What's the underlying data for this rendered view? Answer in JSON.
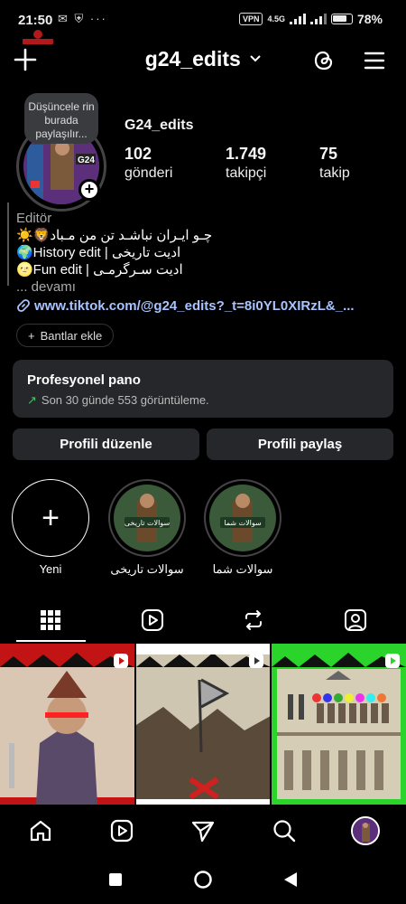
{
  "status": {
    "time": "21:50",
    "left_icons": "✉ ⛨ ···",
    "vpn": "VPN",
    "network": "4.5G",
    "battery_pct": "78%"
  },
  "header": {
    "username": "g24_edits"
  },
  "profile": {
    "note": "Düşüncele rin burada paylaşılır...",
    "display_name": "G24_edits",
    "stats": [
      {
        "value": "102",
        "label": "gönderi"
      },
      {
        "value": "1.749",
        "label": "takipçi"
      },
      {
        "value": "75",
        "label": "takip"
      }
    ],
    "category": "Editör",
    "bio_lines": [
      "☀️🦁چـو ایـران نباشـد تن من مـباد",
      "🌍History edit | ادیت تاریخی",
      "🌝Fun edit | ادیت سـرگرمـی"
    ],
    "more": "... devamı",
    "link": "www.tiktok.com/@g24_edits?_t=8i0YL0XIRzL&_...",
    "add_banners": "Bantlar ekle"
  },
  "pro_dashboard": {
    "title": "Profesyonel pano",
    "subtitle": "Son 30 günde 553 görüntüleme."
  },
  "buttons": {
    "edit": "Profili düzenle",
    "share": "Profili paylaş"
  },
  "highlights": [
    {
      "label": "Yeni"
    },
    {
      "label": "سوالات تاریخی"
    },
    {
      "label": "سوالات شما"
    }
  ],
  "colors": {
    "background": "#000000",
    "card": "#26272b",
    "link": "#a8c4ff",
    "trend": "#3fc466"
  }
}
